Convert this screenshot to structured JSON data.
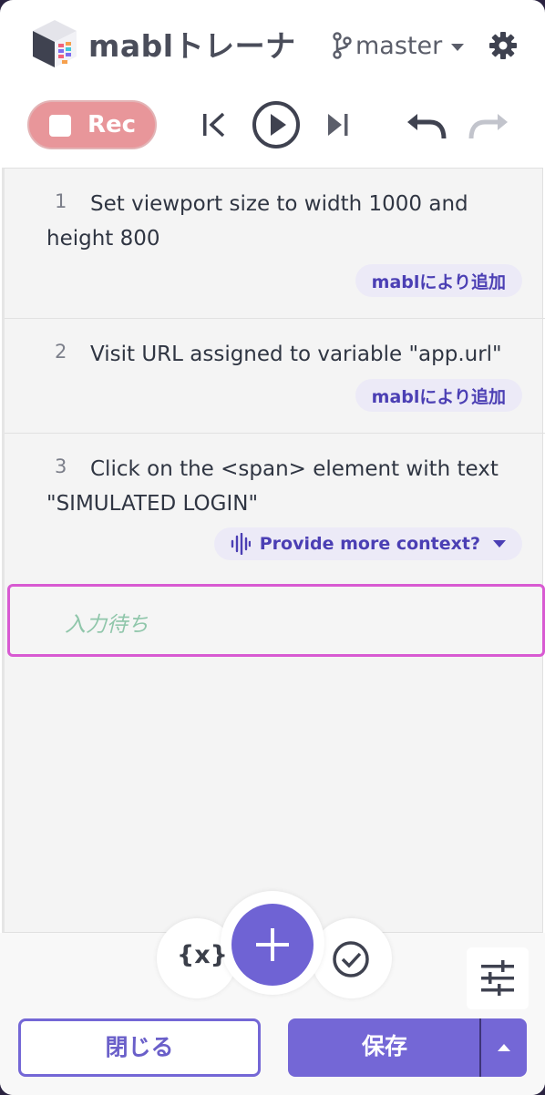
{
  "header": {
    "title": "mablトレーナ",
    "branch": "master"
  },
  "toolbar": {
    "rec_label": "Rec"
  },
  "steps": [
    {
      "number": "1",
      "text": "Set viewport size to width 1000 and height 800",
      "tag": "mablにより追加"
    },
    {
      "number": "2",
      "text": "Visit URL assigned to variable \"app.url\"",
      "tag": "mablにより追加"
    },
    {
      "number": "3",
      "text": "Click on the <span> element with text \"SIMULATED LOGIN\"",
      "tag": "Provide more context?"
    }
  ],
  "waiting": {
    "label": "入力待ち"
  },
  "bottom": {
    "variables_label": "{x}",
    "close_label": "閉じる",
    "save_label": "保存"
  },
  "colors": {
    "accent": "#7467d6",
    "record": "#e8969a",
    "waiting_border": "#d85ad2"
  }
}
